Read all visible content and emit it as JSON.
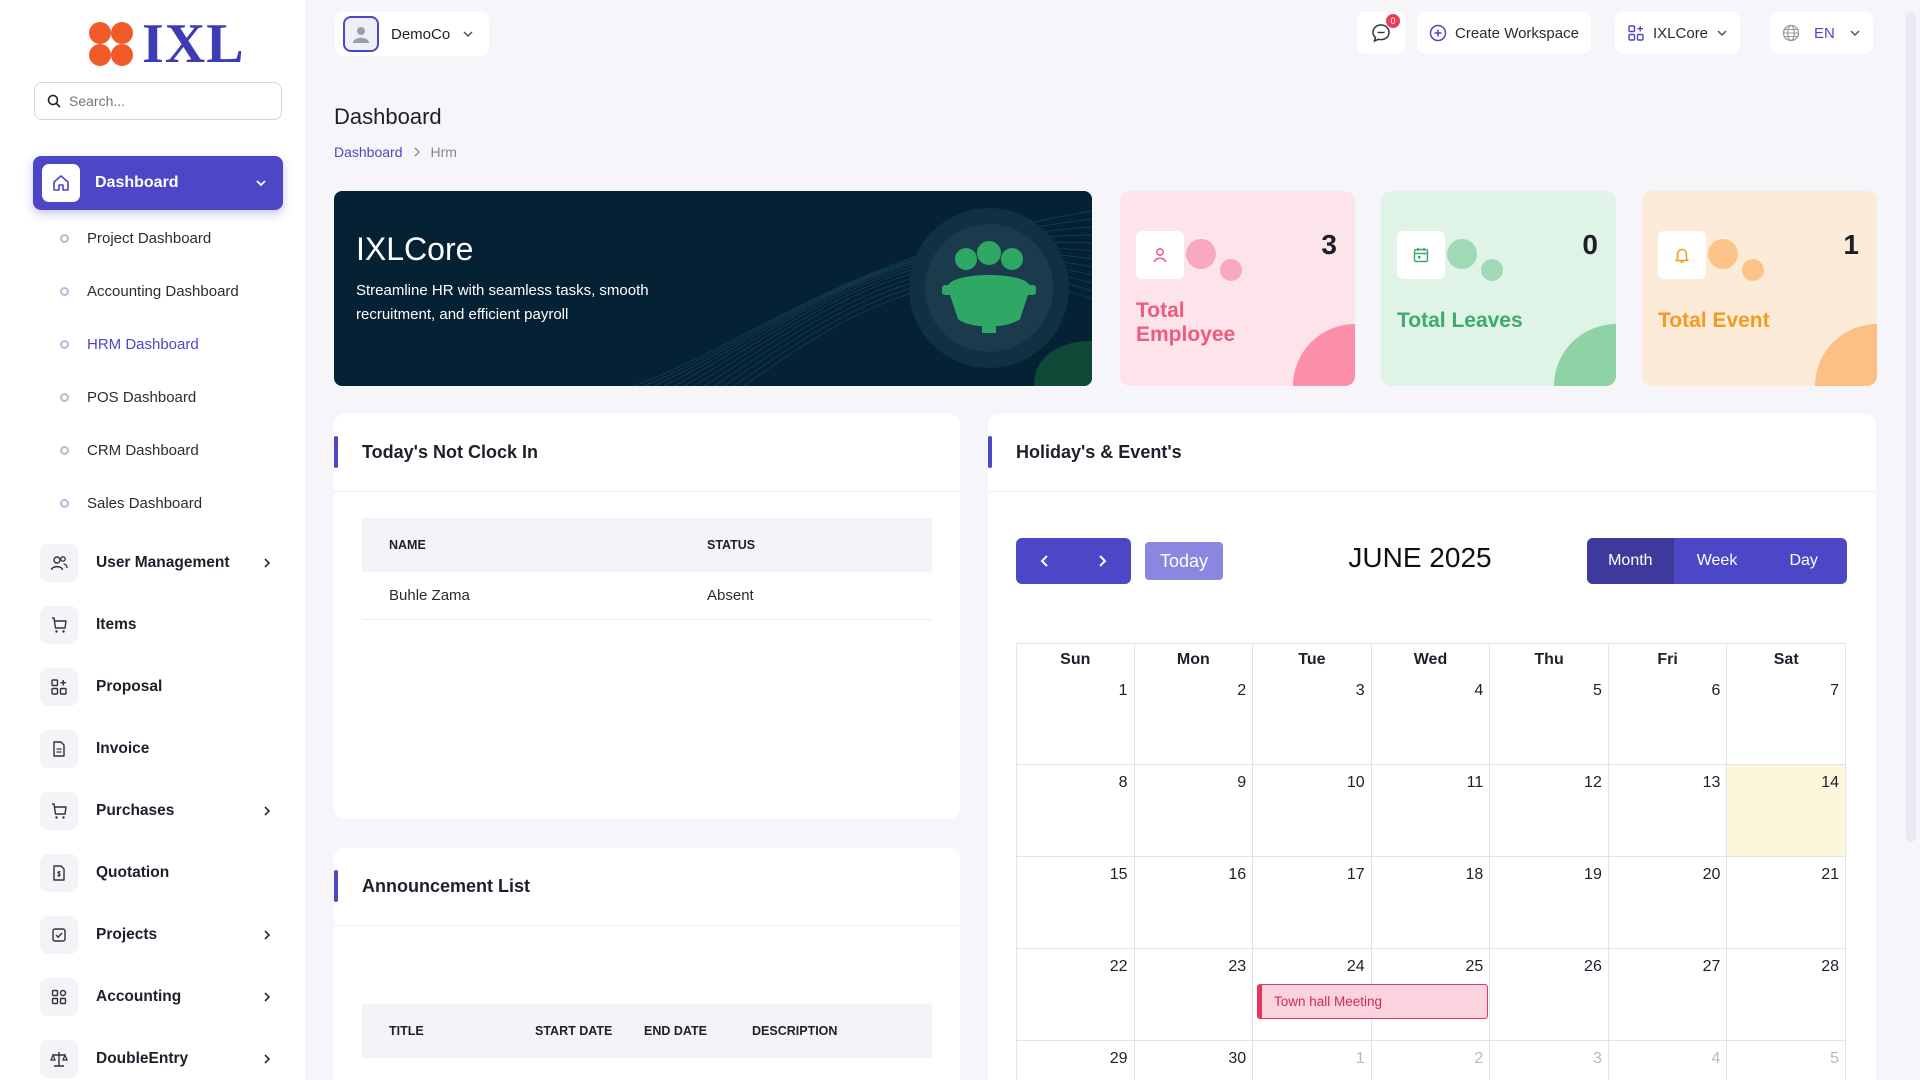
{
  "brand": {
    "name": "IXL"
  },
  "sidebar": {
    "search_placeholder": "Search...",
    "active": {
      "label": "Dashboard"
    },
    "sub_items": [
      {
        "label": "Project Dashboard"
      },
      {
        "label": "Accounting Dashboard"
      },
      {
        "label": "HRM Dashboard"
      },
      {
        "label": "POS Dashboard"
      },
      {
        "label": "CRM Dashboard"
      },
      {
        "label": "Sales Dashboard"
      }
    ],
    "items": [
      {
        "label": "User Management",
        "icon": "users-icon"
      },
      {
        "label": "Items",
        "icon": "cart-icon"
      },
      {
        "label": "Proposal",
        "icon": "grid-plus-icon"
      },
      {
        "label": "Invoice",
        "icon": "file-icon"
      },
      {
        "label": "Purchases",
        "icon": "cart-icon"
      },
      {
        "label": "Quotation",
        "icon": "file-dollar-icon"
      },
      {
        "label": "Projects",
        "icon": "check-square-icon"
      },
      {
        "label": "Accounting",
        "icon": "apps-icon"
      },
      {
        "label": "DoubleEntry",
        "icon": "scale-icon"
      }
    ]
  },
  "topbar": {
    "company": "DemoCo",
    "notifications_count": "0",
    "create_workspace": "Create Workspace",
    "workspace": "IXLCore",
    "language": "EN"
  },
  "page": {
    "title": "Dashboard",
    "breadcrumb": [
      "Dashboard",
      "Hrm"
    ]
  },
  "hero": {
    "title": "IXLCore",
    "subtitle": "Streamline HR with seamless tasks, smooth recruitment, and efficient payroll"
  },
  "stats": [
    {
      "label": "Total Employee",
      "value": "3",
      "color": "#f05a7e",
      "bg": "#fde4ea"
    },
    {
      "label": "Total Leaves",
      "value": "0",
      "color": "#3faa6e",
      "bg": "#dff3e7"
    },
    {
      "label": "Total Event",
      "value": "1",
      "color": "#f39a1f",
      "bg": "#fdebd9"
    }
  ],
  "not_clock_in": {
    "title": "Today's Not Clock In",
    "columns": [
      "NAME",
      "STATUS"
    ],
    "rows": [
      {
        "name": "Buhle Zama",
        "status": "Absent"
      }
    ]
  },
  "announcements": {
    "title": "Announcement List",
    "columns": [
      "TITLE",
      "START DATE",
      "END DATE",
      "DESCRIPTION"
    ]
  },
  "calendar": {
    "title": "Holiday's & Event's",
    "today_label": "Today",
    "month_label": "JUNE 2025",
    "views": [
      "Month",
      "Week",
      "Day"
    ],
    "weekdays": [
      "Sun",
      "Mon",
      "Tue",
      "Wed",
      "Thu",
      "Fri",
      "Sat"
    ],
    "weeks": [
      [
        "1",
        "2",
        "3",
        "4",
        "5",
        "6",
        "7"
      ],
      [
        "8",
        "9",
        "10",
        "11",
        "12",
        "13",
        "14"
      ],
      [
        "15",
        "16",
        "17",
        "18",
        "19",
        "20",
        "21"
      ],
      [
        "22",
        "23",
        "24",
        "25",
        "26",
        "27",
        "28"
      ],
      [
        "29",
        "30",
        "1",
        "2",
        "3",
        "4",
        "5"
      ]
    ],
    "today_date": "14",
    "event": {
      "label": "Town hall Meeting"
    }
  },
  "colors": {
    "accent": "#4b47c7",
    "hero_bg": "#052234"
  }
}
